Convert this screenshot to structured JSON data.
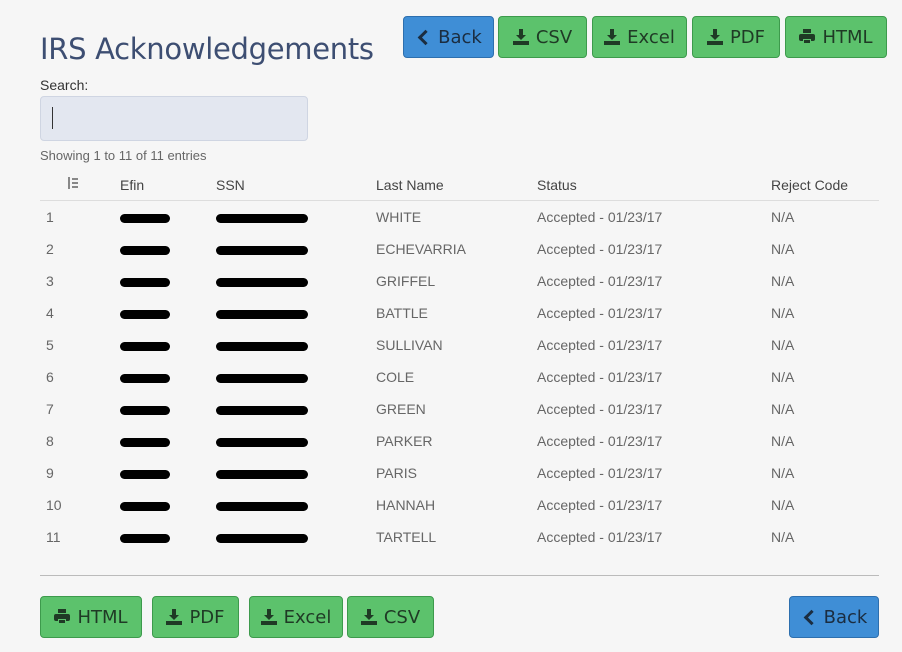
{
  "page": {
    "title": "IRS Acknowledgements"
  },
  "toolbar_top": {
    "back": "Back",
    "csv": "CSV",
    "excel": "Excel",
    "pdf": "PDF",
    "html": "HTML"
  },
  "toolbar_bottom": {
    "html": "HTML",
    "pdf": "PDF",
    "excel": "Excel",
    "csv": "CSV",
    "back": "Back"
  },
  "search": {
    "label": "Search:",
    "value": "",
    "placeholder": ""
  },
  "info": "Showing 1 to 11 of 11 entries",
  "table": {
    "headers": [
      "",
      "Efin",
      "SSN",
      "Last Name",
      "Status",
      "Reject Code"
    ],
    "rows": [
      {
        "num": "1",
        "last": "WHITE",
        "status": "Accepted - 01/23/17",
        "reject": "N/A"
      },
      {
        "num": "2",
        "last": "ECHEVARRIA",
        "status": "Accepted - 01/23/17",
        "reject": "N/A"
      },
      {
        "num": "3",
        "last": "GRIFFEL",
        "status": "Accepted - 01/23/17",
        "reject": "N/A"
      },
      {
        "num": "4",
        "last": "BATTLE",
        "status": "Accepted - 01/23/17",
        "reject": "N/A"
      },
      {
        "num": "5",
        "last": "SULLIVAN",
        "status": "Accepted - 01/23/17",
        "reject": "N/A"
      },
      {
        "num": "6",
        "last": "COLE",
        "status": "Accepted - 01/23/17",
        "reject": "N/A"
      },
      {
        "num": "7",
        "last": "GREEN",
        "status": "Accepted - 01/23/17",
        "reject": "N/A"
      },
      {
        "num": "8",
        "last": "PARKER",
        "status": "Accepted - 01/23/17",
        "reject": "N/A"
      },
      {
        "num": "9",
        "last": "PARIS",
        "status": "Accepted - 01/23/17",
        "reject": "N/A"
      },
      {
        "num": "10",
        "last": "HANNAH",
        "status": "Accepted - 01/23/17",
        "reject": "N/A"
      },
      {
        "num": "11",
        "last": "TARTELL",
        "status": "Accepted - 01/23/17",
        "reject": "N/A"
      }
    ]
  },
  "colors": {
    "green": "#5cc26c",
    "blue": "#3f8ed6",
    "title": "#3d4e72"
  }
}
